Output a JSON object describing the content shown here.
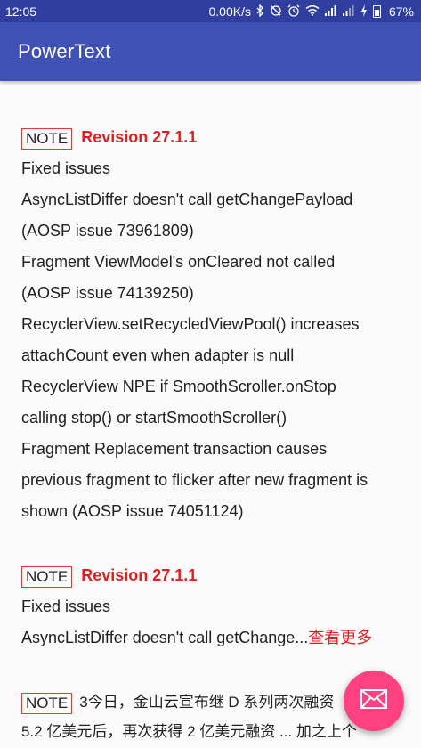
{
  "status_bar": {
    "time": "12:05",
    "network_speed": "0.00K/s",
    "battery": "67%",
    "icons": [
      "bluetooth-icon",
      "sync-icon",
      "alarm-icon",
      "wifi-icon",
      "signal-icon",
      "signal-icon",
      "charging-icon",
      "battery-icon"
    ]
  },
  "app_bar": {
    "title": "PowerText"
  },
  "entries": [
    {
      "tag": "NOTE",
      "revision": "Revision 27.1.1",
      "lines": [
        "Fixed issues",
        "AsyncListDiffer doesn't call getChangePayload",
        "(AOSP issue 73961809)",
        "Fragment ViewModel's onCleared not called",
        "(AOSP issue 74139250)",
        "RecyclerView.setRecycledViewPool() increases",
        "attachCount even when adapter is null",
        "RecyclerView NPE if SmoothScroller.onStop",
        "calling stop() or startSmoothScroller()",
        "Fragment Replacement transaction causes",
        "previous fragment to flicker after new fragment is",
        "shown (AOSP issue 74051124)"
      ]
    },
    {
      "tag": "NOTE",
      "revision": "Revision 27.1.1",
      "lines": [
        "Fixed issues"
      ],
      "truncated_text": "AsyncListDiffer doesn't call getChange...",
      "more_label": "查看更多"
    },
    {
      "tag": "NOTE",
      "line1": "3今日，金山云宣布继 D 系列两次融资",
      "line2": "5.2 亿美元后，再次获得 2 亿美元融资 ... 加之上个"
    }
  ],
  "fab": {
    "icon": "mail-icon"
  },
  "colors": {
    "status_bar": "#303f9f",
    "app_bar": "#3f51b5",
    "accent_red": "#e02020",
    "fab": "#ff4081"
  }
}
